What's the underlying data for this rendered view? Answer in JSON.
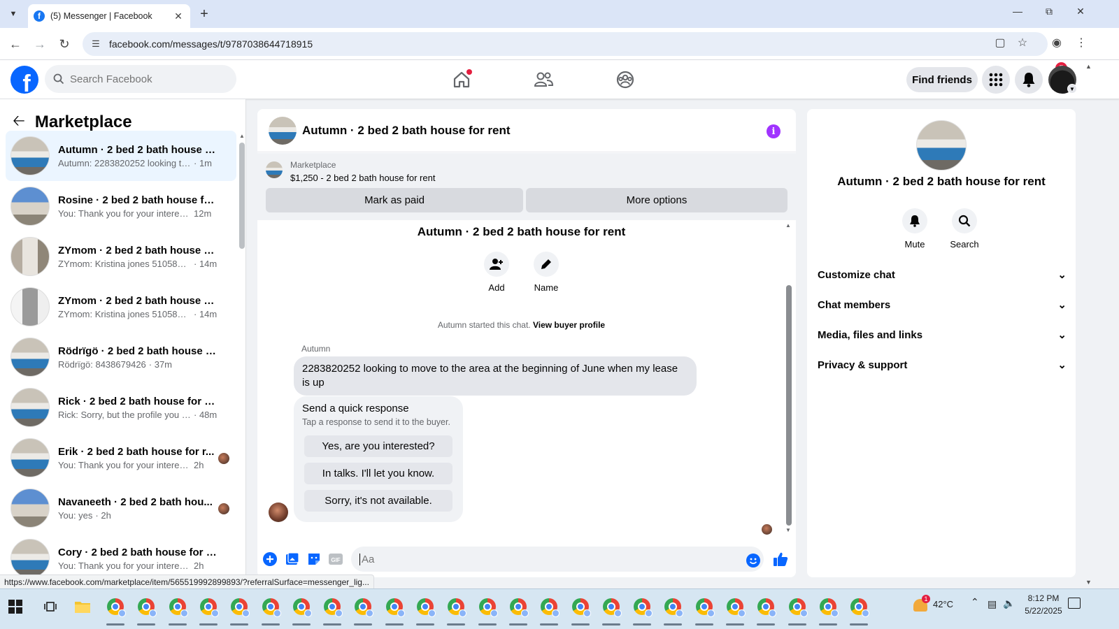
{
  "browser": {
    "tab_title": "(5) Messenger | Facebook",
    "url": "facebook.com/messages/t/9787038644718915",
    "status_url": "https://www.facebook.com/marketplace/item/565519992899893/?referralSurface=messenger_lig..."
  },
  "fb": {
    "search_placeholder": "Search Facebook",
    "find_friends": "Find friends",
    "notification_count": "5",
    "brand_color": "#0866ff"
  },
  "sidebar": {
    "title": "Marketplace",
    "conversations": [
      {
        "name": "Autumn · 2 bed 2 bath house fo...",
        "preview": "Autumn: 2283820252 looking to m...",
        "time": "· 1m",
        "thumb": "bed",
        "active": true
      },
      {
        "name": "Rosine · 2 bed 2 bath house for ...",
        "preview": "You: Thank you for your interest. ...",
        "time": "12m",
        "thumb": "house"
      },
      {
        "name": "ZYmom · 2 bed 2 bath house for...",
        "preview": "ZYmom: Kristina jones 5105867571",
        "time": "· 14m",
        "thumb": "room"
      },
      {
        "name": "ZYmom · 2 bed 2 bath house for...",
        "preview": "ZYmom: Kristina jones 5105867571",
        "time": "· 14m",
        "thumb": "wash"
      },
      {
        "name": "Rödrïgö · 2 bed 2 bath house fo...",
        "preview": "Rödrïgö: 8438679426",
        "time": "· 37m",
        "thumb": "bed"
      },
      {
        "name": "Rick · 2 bed 2 bath house for rent",
        "preview": "Rick: Sorry, but the profile you ha...",
        "time": "· 48m",
        "thumb": "bed"
      },
      {
        "name": "Erik · 2 bed 2 bath house for r...",
        "preview": "You: Thank you for your interest....",
        "time": "2h",
        "thumb": "bed",
        "seen": true
      },
      {
        "name": "Navaneeth · 2 bed 2 bath hou...",
        "preview": "You: yes",
        "time": "· 2h",
        "thumb": "house",
        "seen": true
      },
      {
        "name": "Cory · 2 bed 2 bath house for rent",
        "preview": "You: Thank you for your interest. Th...",
        "time": "2h",
        "thumb": "bed"
      }
    ]
  },
  "chat": {
    "title": "Autumn · 2 bed 2 bath house for rent",
    "marketplace_label": "Marketplace",
    "listing": "$1,250 - 2 bed 2 bath house for rent",
    "mark_paid": "Mark as paid",
    "more_options": "More options",
    "group_title": "Autumn · 2 bed 2 bath house for rent",
    "add_label": "Add",
    "name_label": "Name",
    "system_prefix": "Autumn started this chat. ",
    "system_link": "View buyer profile",
    "sender": "Autumn",
    "message": "2283820252 looking to move to the area at the beginning of June when my lease is up",
    "quick_title": "Send a quick response",
    "quick_sub": "Tap a response to send it to the buyer.",
    "quick_responses": [
      "Yes, are you interested?",
      "In talks. I'll let you know.",
      "Sorry, it's not available."
    ],
    "composer_placeholder": "Aa"
  },
  "info": {
    "title": "Autumn · 2 bed 2 bath house for rent",
    "mute": "Mute",
    "search": "Search",
    "sections": [
      "Customize chat",
      "Chat members",
      "Media, files and links",
      "Privacy & support"
    ]
  },
  "taskbar": {
    "weather_badge": "1",
    "temperature": "42°C",
    "time": "8:12 PM",
    "date": "5/22/2025"
  }
}
